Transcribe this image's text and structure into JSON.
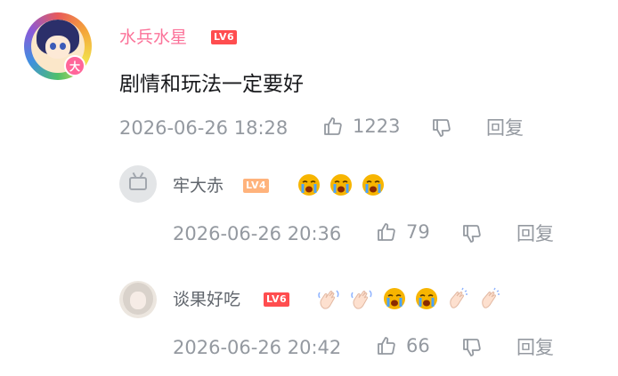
{
  "comment": {
    "username": "水兵水星",
    "level": "LV6",
    "avatar_badge": "大",
    "text": "剧情和玩法一定要好",
    "time": "2026-06-26 18:28",
    "likes": "1223",
    "reply_label": "回复"
  },
  "replies": [
    {
      "username": "牢大赤",
      "level": "LV4",
      "emojis": [
        "crying-face-icon",
        "crying-face-icon",
        "crying-face-icon"
      ],
      "time": "2026-06-26 20:36",
      "likes": "79",
      "reply_label": "回复"
    },
    {
      "username": "谈果好吃",
      "level": "LV6",
      "emojis": [
        "waving-hand-icon",
        "waving-hand-icon",
        "crying-face-icon",
        "crying-face-icon",
        "clapping-hands-icon",
        "clapping-hands-icon"
      ],
      "time": "2026-06-26 20:42",
      "likes": "66",
      "reply_label": "回复"
    }
  ],
  "colors": {
    "username_vip": "#fb7299",
    "username": "#61666d",
    "meta": "#9499a0",
    "text": "#18191c",
    "lv6": "#ff4d4f",
    "lv4": "#ffb37c"
  }
}
